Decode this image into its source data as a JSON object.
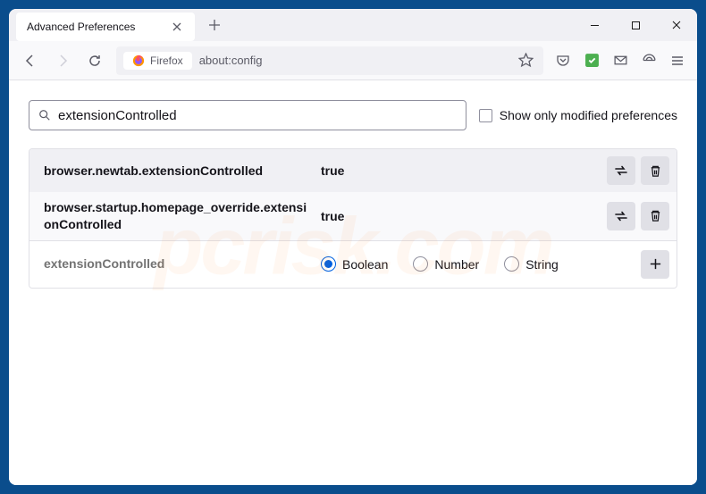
{
  "tab": {
    "title": "Advanced Preferences"
  },
  "urlbar": {
    "identity": "Firefox",
    "url": "about:config"
  },
  "search": {
    "value": "extensionControlled",
    "modified_only_label": "Show only modified preferences"
  },
  "prefs": [
    {
      "name": "browser.newtab.extensionControlled",
      "value": "true"
    },
    {
      "name": "browser.startup.homepage_override.extensionControlled",
      "value": "true"
    }
  ],
  "new_pref": {
    "name": "extensionControlled",
    "types": {
      "boolean": "Boolean",
      "number": "Number",
      "string": "String"
    }
  },
  "watermark": "pcrisk.com"
}
